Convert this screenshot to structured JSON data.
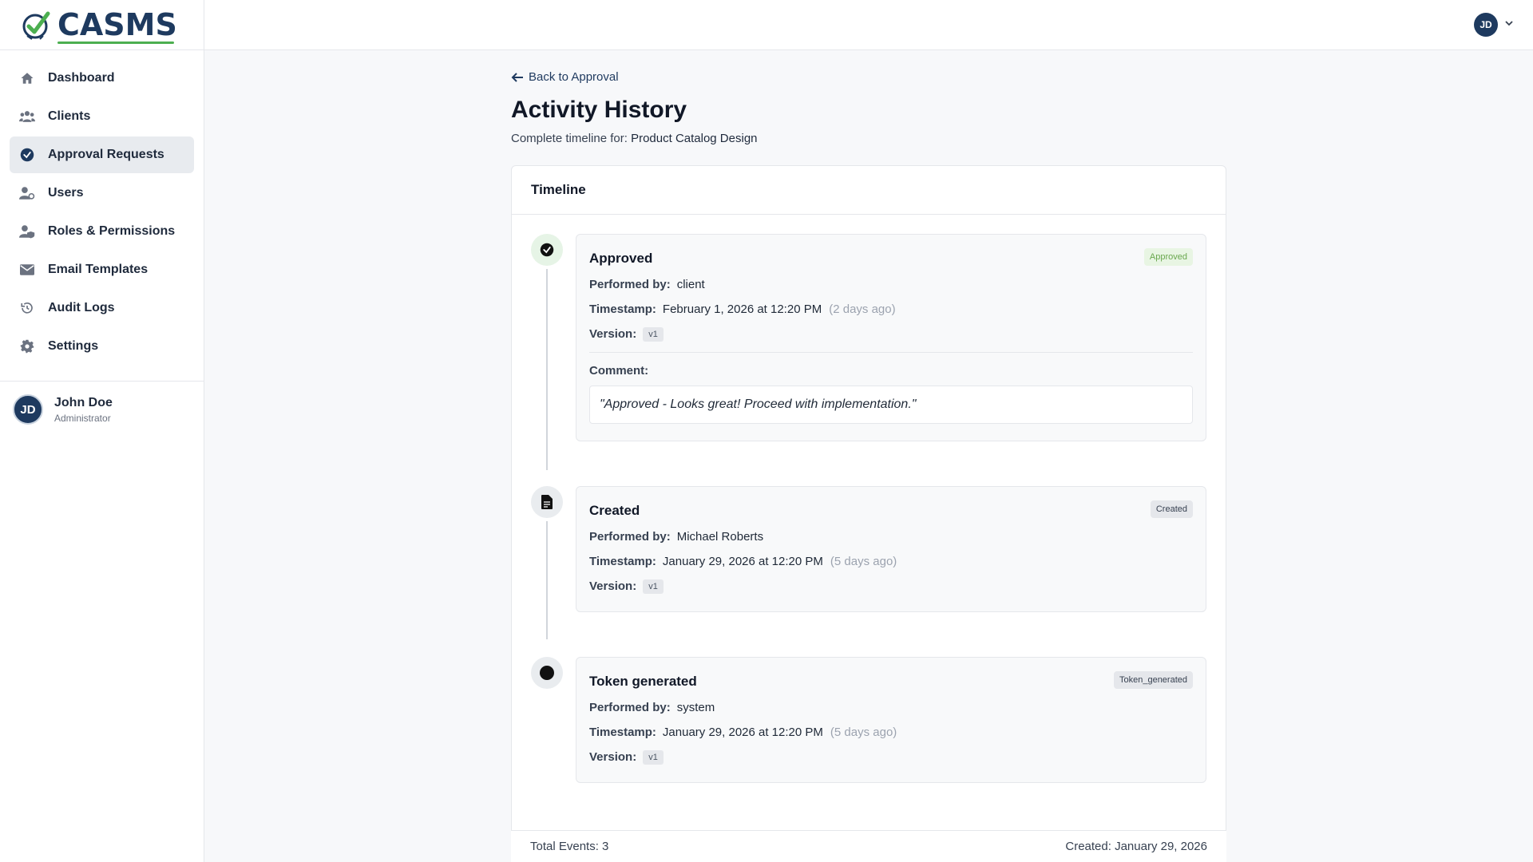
{
  "app": {
    "brand": "CASMS"
  },
  "sidebar": {
    "items": [
      {
        "label": "Dashboard",
        "icon": "home-icon"
      },
      {
        "label": "Clients",
        "icon": "clients-icon"
      },
      {
        "label": "Approval Requests",
        "icon": "check-circle-icon",
        "active": true
      },
      {
        "label": "Users",
        "icon": "user-cog-icon"
      },
      {
        "label": "Roles & Permissions",
        "icon": "user-shield-icon"
      },
      {
        "label": "Email Templates",
        "icon": "envelope-icon"
      },
      {
        "label": "Audit Logs",
        "icon": "history-icon"
      },
      {
        "label": "Settings",
        "icon": "gear-icon"
      }
    ],
    "user": {
      "initials": "JD",
      "name": "John Doe",
      "role": "Administrator"
    }
  },
  "header": {
    "initials": "JD"
  },
  "main": {
    "back_label": "Back to Approval",
    "title": "Activity History",
    "subtitle_prefix": "Complete timeline for:",
    "project": "Product Catalog Design",
    "timeline_title": "Timeline",
    "labels": {
      "performed_by": "Performed by:",
      "timestamp": "Timestamp:",
      "version": "Version:",
      "comment": "Comment:"
    },
    "events": [
      {
        "title": "Approved",
        "badge": "Approved",
        "performed_by": "client",
        "timestamp": "February 1, 2026 at 12:20 PM",
        "ago": "(2 days ago)",
        "version": "v1",
        "comment": "\"Approved - Looks great! Proceed with implementation.\""
      },
      {
        "title": "Created",
        "badge": "Created",
        "performed_by": "Michael Roberts",
        "timestamp": "January 29, 2026 at 12:20 PM",
        "ago": "(5 days ago)",
        "version": "v1"
      },
      {
        "title": "Token generated",
        "badge": "Token_generated",
        "performed_by": "system",
        "timestamp": "January 29, 2026 at 12:20 PM",
        "ago": "(5 days ago)",
        "version": "v1"
      }
    ],
    "footer": {
      "total": "Total Events: 3",
      "created": "Created: January 29, 2026"
    }
  },
  "colors": {
    "brand": "#1e3a5f",
    "accent": "#4caf50",
    "approved_badge": "#6aa84f"
  }
}
